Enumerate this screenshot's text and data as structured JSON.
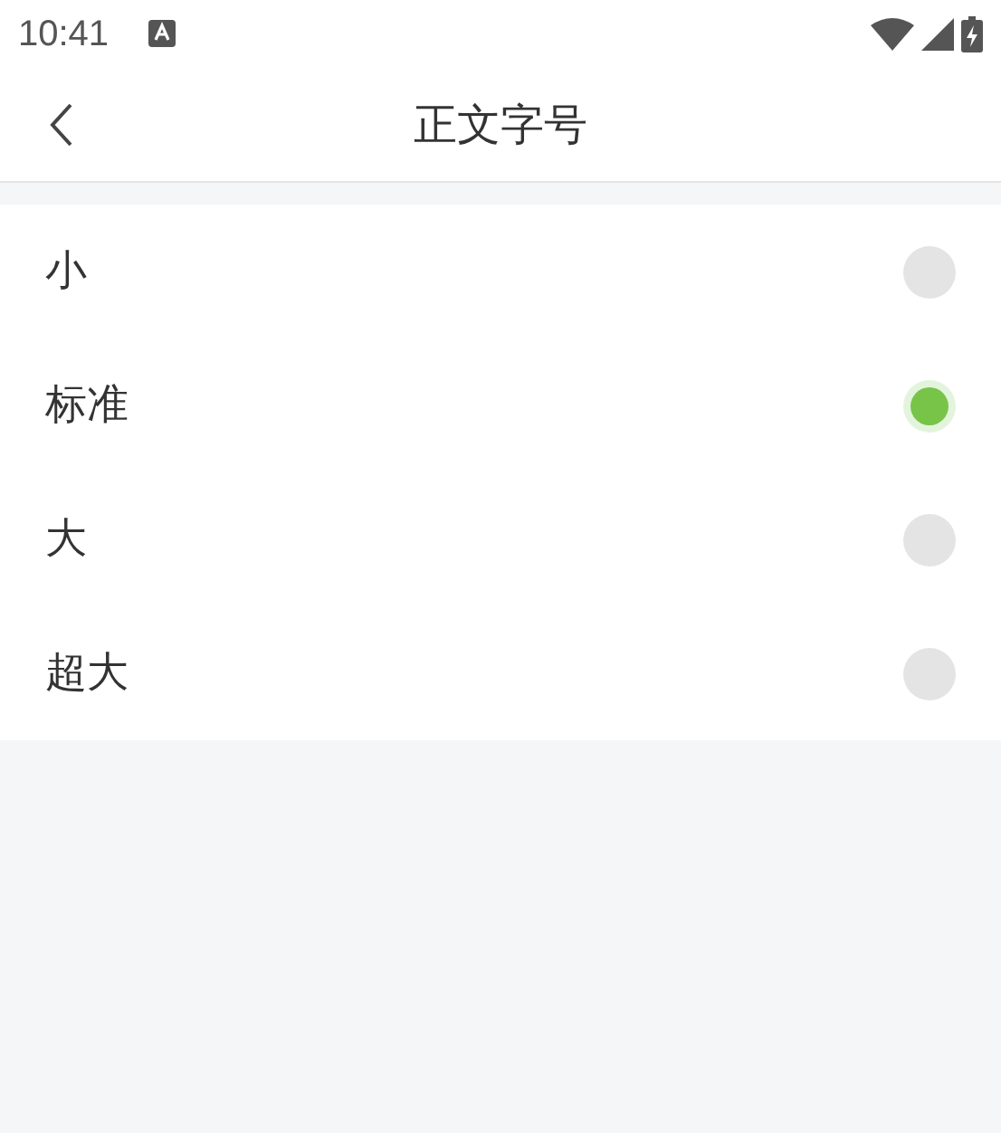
{
  "status_bar": {
    "time": "10:41"
  },
  "header": {
    "title": "正文字号"
  },
  "options": [
    {
      "label": "小",
      "selected": false
    },
    {
      "label": "标准",
      "selected": true
    },
    {
      "label": "大",
      "selected": false
    },
    {
      "label": "超大",
      "selected": false
    }
  ]
}
